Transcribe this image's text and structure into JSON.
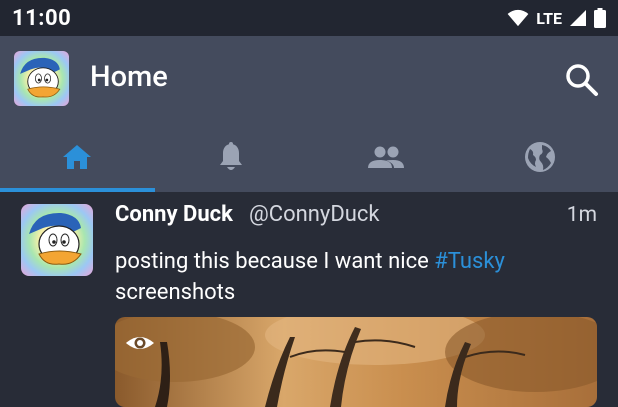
{
  "status_bar": {
    "time": "11:00",
    "network": "LTE"
  },
  "app_bar": {
    "title": "Home"
  },
  "tabs": [
    {
      "name": "home",
      "active": true
    },
    {
      "name": "notifications",
      "active": false
    },
    {
      "name": "local",
      "active": false
    },
    {
      "name": "federated",
      "active": false
    }
  ],
  "status": {
    "display_name": "Conny Duck",
    "username": "@ConnyDuck",
    "time": "1m",
    "content_text": "posting this because I want nice ",
    "hashtag": "#Tusky",
    "content_text_2": "screenshots"
  },
  "colors": {
    "accent": "#2b90d9",
    "background": "#282c37",
    "toolbar": "#444b5d",
    "status_bar": "#222631"
  }
}
